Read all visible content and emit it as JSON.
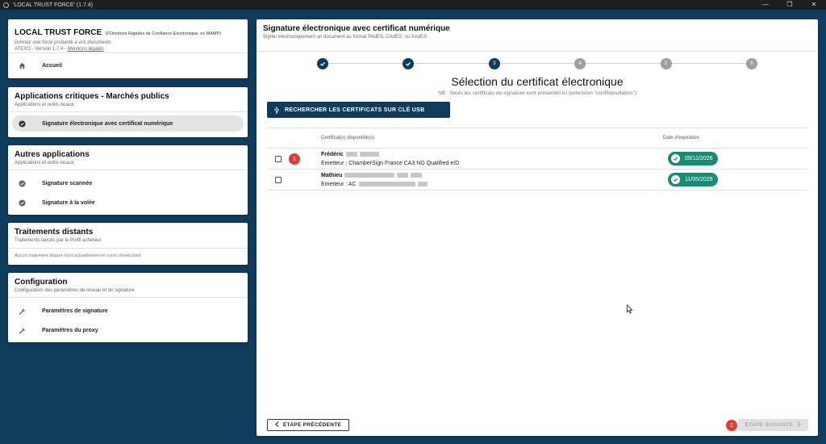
{
  "window": {
    "title": "'LOCAL TRUST FORCE' (1.7.4)",
    "controls": [
      "—",
      "❐",
      "✕"
    ]
  },
  "app_card": {
    "title": "LOCAL TRUST FORCE",
    "title_suffix": "(FOnctions Rapides de Confiance Electronique, ex MAMP)",
    "tagline": "Donnez une force probante à vos documents",
    "version": "ATEXO - Version 1.7.4 -",
    "legal_link": "Mentions légales",
    "home_label": "Accueil"
  },
  "critical_apps": {
    "title": "Applications critiques - Marchés publics",
    "subtitle": "Applications et outils locaux",
    "items": [
      {
        "label": "Signature électronique avec certificat numérique",
        "active": true
      }
    ]
  },
  "other_apps": {
    "title": "Autres applications",
    "subtitle": "Applications et outils locaux",
    "items": [
      {
        "label": "Signature scannée"
      },
      {
        "label": "Signature à la volée"
      }
    ]
  },
  "remote": {
    "title": "Traitements distants",
    "subtitle": "Traitements lancés par le Profil acheteur",
    "empty": "Aucun traitement distant n'est actuellement en cours d'exécution."
  },
  "config": {
    "title": "Configuration",
    "subtitle": "Configuration des paramètres de réseau et de signature",
    "items": [
      {
        "label": "Paramètres de signature"
      },
      {
        "label": "Paramètres du proxy"
      }
    ]
  },
  "main": {
    "title": "Signature électronique avec certificat numérique",
    "subtitle": "Signer électroniquement un document au format PAdES, CAdES, ou XAdES",
    "steps": [
      {
        "label": "1",
        "state": "done"
      },
      {
        "label": "2",
        "state": "done"
      },
      {
        "label": "3",
        "state": "current"
      },
      {
        "label": "4",
        "state": "todo"
      },
      {
        "label": "5",
        "state": "todo"
      },
      {
        "label": "6",
        "state": "todo"
      }
    ],
    "heading": "Sélection du certificat électronique",
    "note": "NB : Seuls les certificats de signature sont présentés ici (extension \"nonRepudiation\")",
    "usb_button": "RECHERCHER LES CERTIFICATS SUR CLÉ USB",
    "table": {
      "col_cert": "Certificat(s) disponible(s)",
      "col_date": "Date d'expiration",
      "rows": [
        {
          "badge": "1",
          "name": "Frédéric",
          "issuer": "Emetteur : ChamberSign France CA3 NG Qualified eID",
          "date": "09/11/2026"
        },
        {
          "badge": "",
          "name": "Mathieu",
          "issuer": "Emetteur : AC",
          "date": "11/05/2029"
        }
      ]
    },
    "prev_button": "ÉTAPE PRÉCÉDENTE",
    "next_button": "ÉTAPE SUIVANTE",
    "next_badge": "2"
  },
  "colors": {
    "navy": "#0f3b5c",
    "teal": "#1a8a74",
    "badge_red": "#e53935"
  }
}
